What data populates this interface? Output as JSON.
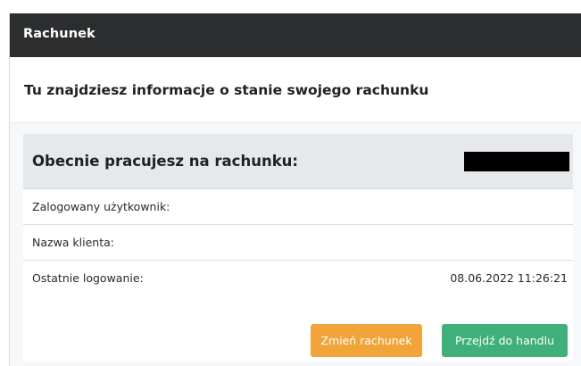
{
  "panel": {
    "header_title": "Rachunek",
    "subtitle": "Tu znajdziesz informacje o stanie swojego rachunku"
  },
  "account": {
    "current_label": "Obecnie pracujesz na rachunku:",
    "rows": [
      {
        "label": "Zalogowany użytkownik:",
        "value": ""
      },
      {
        "label": "Nazwa klienta:",
        "value": ""
      },
      {
        "label": "Ostatnie logowanie:",
        "value": "08.06.2022 11:26:21"
      }
    ]
  },
  "buttons": {
    "change_account": "Zmień rachunek",
    "go_to_trading": "Przejdź do handlu"
  },
  "colors": {
    "header_bg": "#2b2d2f",
    "change_button": "#f0a43a",
    "trade_button": "#3fb07a"
  }
}
